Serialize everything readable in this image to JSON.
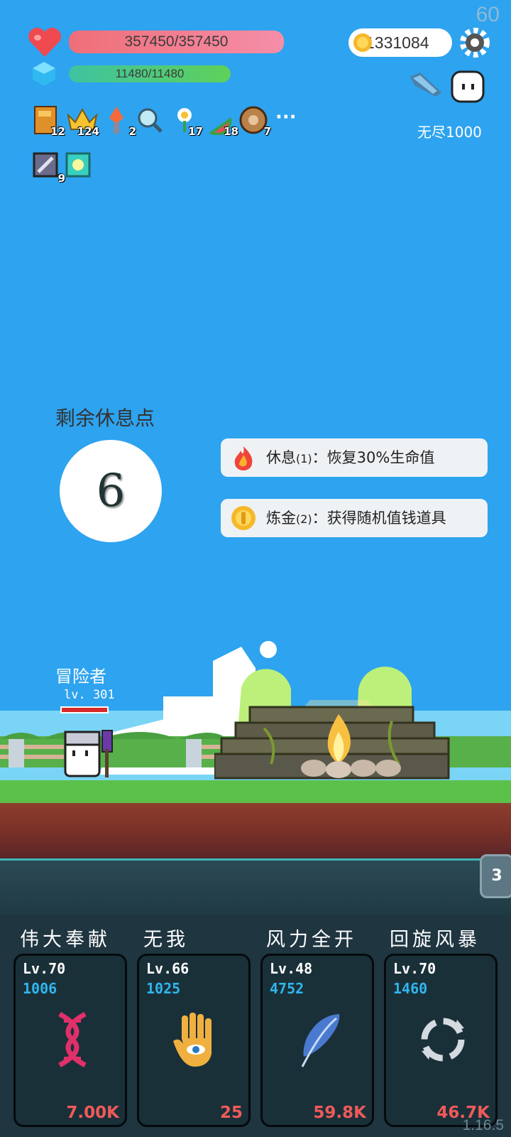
{
  "fps": "60",
  "hp": {
    "text": "357450/357450",
    "icon": "heart-icon"
  },
  "mp": {
    "text": "11480/11480",
    "icon": "crystal-icon"
  },
  "coins": "1331084",
  "endless_label": "无尽1000",
  "items": [
    {
      "icon": "book-icon",
      "count": "12"
    },
    {
      "icon": "crown-icon",
      "count": "124"
    },
    {
      "icon": "torch-icon",
      "count": "2"
    },
    {
      "icon": "magnifier-icon",
      "count": ""
    },
    {
      "icon": "flower-icon",
      "count": "17"
    },
    {
      "icon": "watermelon-icon",
      "count": "18"
    },
    {
      "icon": "shield-icon",
      "count": "7"
    },
    {
      "icon": "sword-icon",
      "count": "9"
    },
    {
      "icon": "gem-icon",
      "count": ""
    }
  ],
  "more_label": "···",
  "rest": {
    "label": "剩余休息点",
    "points": "6"
  },
  "options": [
    {
      "icon": "fire-icon",
      "title": "休息",
      "cost": "(1)",
      "desc": "：恢复30%生命值"
    },
    {
      "icon": "coin-icon",
      "title": "炼金",
      "cost": "(2)",
      "desc": "：获得随机值钱道具"
    }
  ],
  "hero": {
    "name": "冒险者",
    "level": "lv. 301"
  },
  "wave_badge": "3",
  "skills": [
    {
      "name": "伟大奉献",
      "level": "Lv.70",
      "mp": "1006",
      "cost": "7.00K",
      "icon": "dna-icon"
    },
    {
      "name": "无我",
      "level": "Lv.66",
      "mp": "1025",
      "cost": "25",
      "icon": "eye-hand-icon"
    },
    {
      "name": "风力全开",
      "level": "Lv.48",
      "mp": "4752",
      "cost": "59.8K",
      "icon": "feather-icon"
    },
    {
      "name": "回旋风暴",
      "level": "Lv.70",
      "mp": "1460",
      "cost": "46.7K",
      "icon": "cycle-icon"
    }
  ],
  "version": "1.16.5",
  "colors": {
    "sky": "#2ea3ef",
    "hp": "#f07a8c",
    "mp": "#4ccb78",
    "cost": "#ef5a5a",
    "mp_text": "#2fb6ee"
  }
}
